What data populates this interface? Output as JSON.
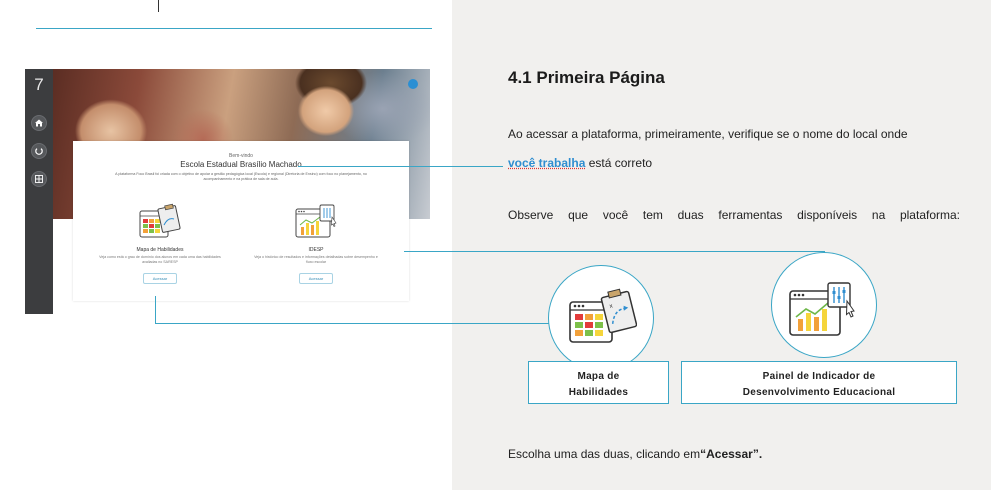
{
  "screenshot": {
    "number": "7",
    "sidebar_icons": [
      "home-icon",
      "power-icon",
      "grid-icon"
    ],
    "welcome": "Bem-vindo",
    "school_name": "Escola Estadual Brasílio Machado",
    "description": "A plataforma Foco Brasil foi criada com o objetivo de apoiar a gestão pedagógica local (Escola) e regional (Diretoria de Ensino) com foco no planejamento, no acompanhamento e na prática de sala de aula.",
    "tools": [
      {
        "title": "Mapa de Habilidades",
        "description": "Veja como está o grau de domínio dos alunos em cada uma das habilidades avaliadas no SARESP",
        "button": "Acessar"
      },
      {
        "title": "IDESP",
        "description": "Veja o histórico de resultados e informações detalhadas sobre desempenho e fluxo escolar",
        "button": "Acessar"
      }
    ]
  },
  "content": {
    "title": "4.1 Primeira Página",
    "para1": "Ao acessar a plataforma, primeiramente, verifique se o nome do local onde",
    "para1_link": "você trabalha",
    "para1_end": "está correto",
    "para2": "Observe que você tem duas ferramentas disponíveis na plataforma:",
    "tool_label_1": [
      "Mapa de",
      "Habilidades"
    ],
    "tool_label_2": [
      "Painel de Indicador de",
      "Desenvolvimento Educacional"
    ],
    "para3_start": "Escolha uma das duas, clicando em",
    "para3_bold": "“Acessar”."
  },
  "colors": {
    "accent": "#3aa6c6",
    "link": "#2f8ed0",
    "sidebar": "#3c3d3f",
    "right_bg": "#f1f0ee"
  }
}
